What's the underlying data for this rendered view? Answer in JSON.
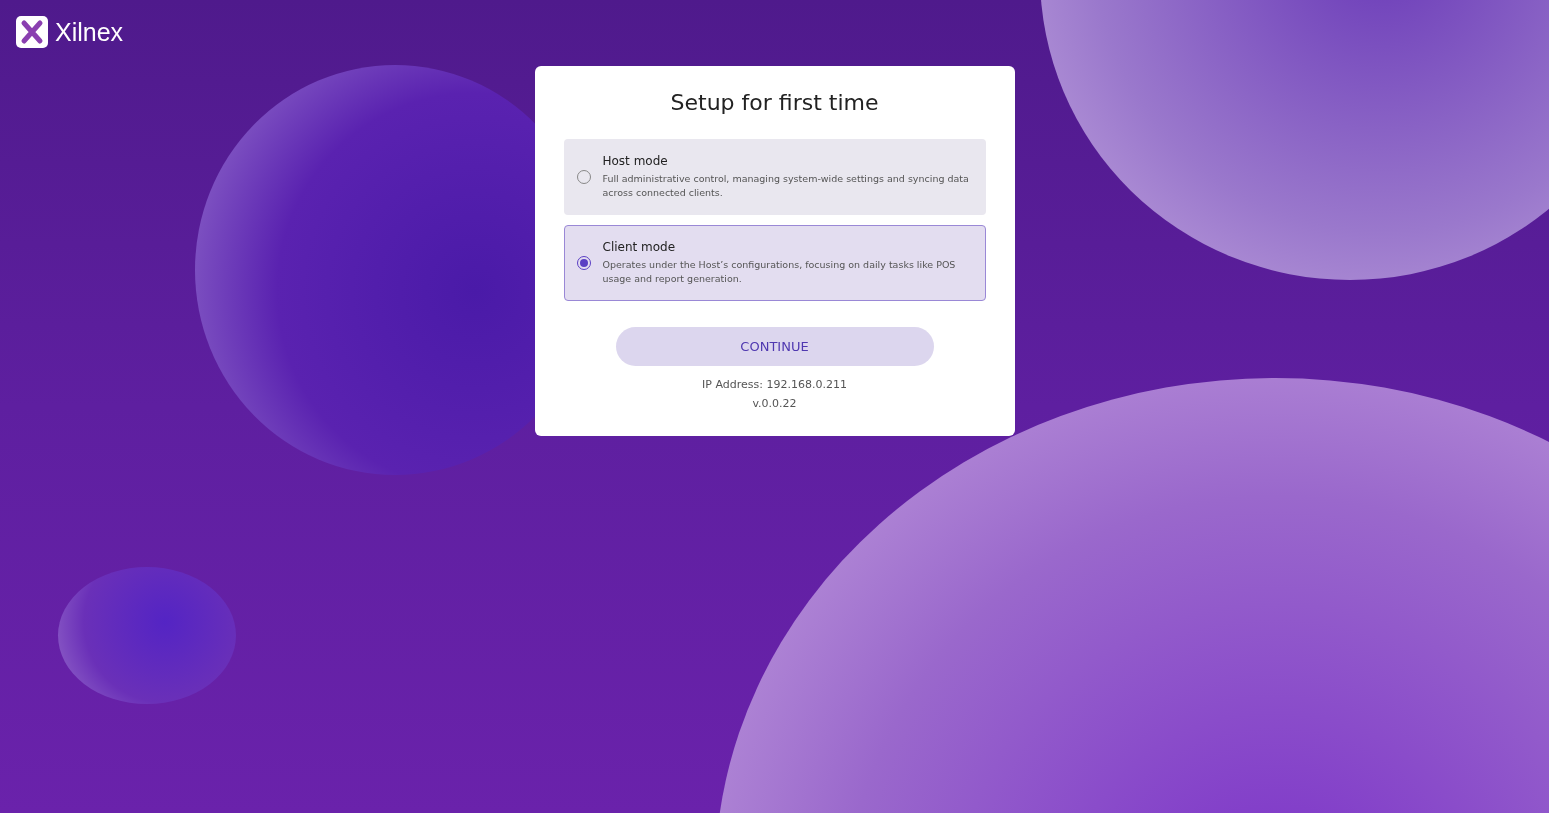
{
  "brand": {
    "name": "Xilnex"
  },
  "dialog": {
    "title": "Setup for first time",
    "options": [
      {
        "title": "Host mode",
        "description": "Full administrative control, managing system-wide settings and syncing data across connected clients.",
        "selected": false
      },
      {
        "title": "Client mode",
        "description": "Operates under the Host’s configurations, focusing on daily tasks like POS usage and report generation.",
        "selected": true
      }
    ],
    "button": "CONTINUE",
    "ip_address": "IP Address: 192.168.0.211",
    "version": "v.0.0.22"
  }
}
